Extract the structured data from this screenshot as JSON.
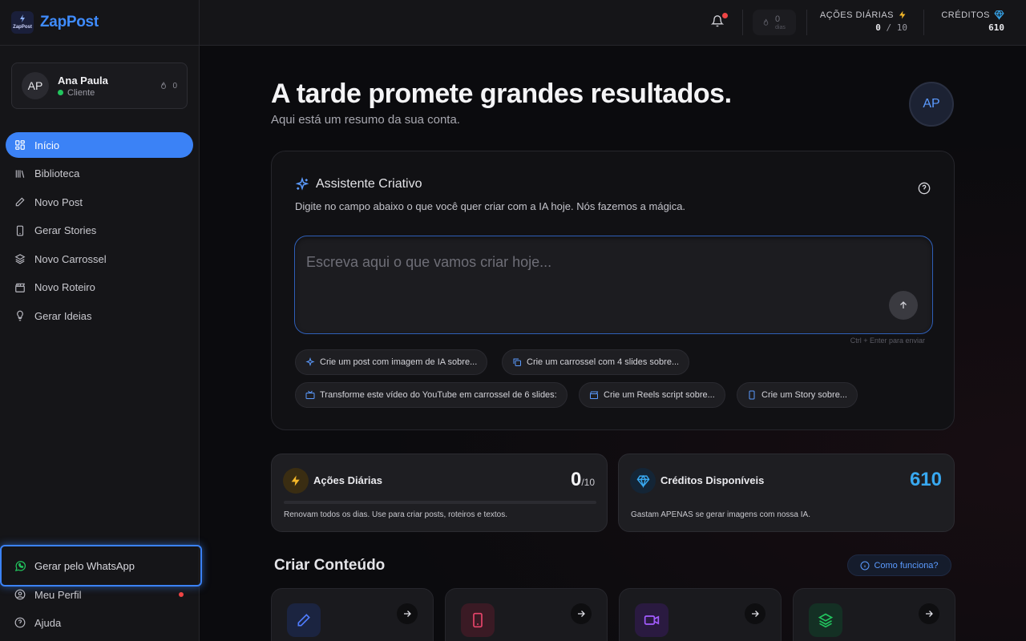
{
  "app": {
    "logo_text": "ZapPost",
    "logo_mark_text": "ZapPost"
  },
  "user": {
    "initials": "AP",
    "name": "Ana Paula",
    "role": "Cliente",
    "streak": "0"
  },
  "nav": {
    "items": [
      {
        "label": "Início",
        "icon": "grid-icon",
        "active": true
      },
      {
        "label": "Biblioteca",
        "icon": "library-icon",
        "active": false
      },
      {
        "label": "Novo Post",
        "icon": "pencil-icon",
        "active": false
      },
      {
        "label": "Gerar Stories",
        "icon": "phone-icon",
        "active": false
      },
      {
        "label": "Novo Carrossel",
        "icon": "layers-icon",
        "active": false
      },
      {
        "label": "Novo Roteiro",
        "icon": "clapperboard-icon",
        "active": false
      },
      {
        "label": "Gerar Ideias",
        "icon": "lightbulb-icon",
        "active": false
      }
    ],
    "whatsapp_label": "Gerar pelo WhatsApp",
    "profile_label": "Meu Perfil",
    "help_label": "Ajuda"
  },
  "topbar": {
    "streak_count": "0",
    "streak_unit": "dias",
    "actions_label": "AÇÕES DIÁRIAS",
    "actions_used": "0",
    "actions_sep": " / ",
    "actions_total": "10",
    "credits_label": "CRÉDITOS",
    "credits_value": "610"
  },
  "main": {
    "greeting": "A tarde promete grandes resultados.",
    "subgreeting": "Aqui está um resumo da sua conta.",
    "avatar_initials": "AP"
  },
  "assistant": {
    "title": "Assistente Criativo",
    "description": "Digite no campo abaixo o que você quer criar com a IA hoje. Nós fazemos a mágica.",
    "placeholder": "Escreva aqui o que vamos criar hoje...",
    "hint": "Ctrl + Enter para enviar",
    "chips": [
      {
        "label": "Crie um post com imagem de IA sobre...",
        "icon": "sparkle-icon"
      },
      {
        "label": "Crie um carrossel com 4 slides sobre...",
        "icon": "copy-icon"
      },
      {
        "label": "Transforme este vídeo do YouTube em carrossel de 6 slides:",
        "icon": "tv-icon"
      },
      {
        "label": "Crie um Reels script sobre...",
        "icon": "clapperboard-icon"
      },
      {
        "label": "Crie um Story sobre...",
        "icon": "phone-icon"
      }
    ]
  },
  "stats": {
    "actions": {
      "title": "Ações Diárias",
      "value": "0",
      "suffix": "/10",
      "progress": 0,
      "description": "Renovam todos os dias. Use para criar posts, roteiros e textos.",
      "color": "#f5b829"
    },
    "credits": {
      "title": "Créditos Disponíveis",
      "value": "610",
      "description": "Gastam APENAS se gerar imagens com nossa IA.",
      "color": "#38a8f0"
    }
  },
  "create": {
    "title": "Criar Conteúdo",
    "how_label": "Como funciona?",
    "cards": [
      {
        "icon": "pencil-icon",
        "color": "#4f7cff"
      },
      {
        "icon": "phone-icon",
        "color": "#e8456b"
      },
      {
        "icon": "video-icon",
        "color": "#a35cff"
      },
      {
        "icon": "layers-icon",
        "color": "#22c55e"
      }
    ]
  },
  "colors": {
    "accent": "#3b82f6",
    "background": "#0b0b0e",
    "sidebar": "#151518"
  }
}
